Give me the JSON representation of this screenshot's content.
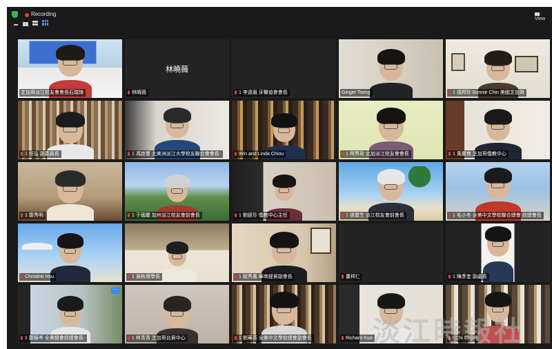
{
  "window": {
    "recording_label": "Recording",
    "view_button_label": "View"
  },
  "participants": [
    {
      "name": "芝加哥淡江校友會會長石瑞琦",
      "mic_off": false,
      "video": true
    },
    {
      "name": "林曉薇",
      "mic_off": true,
      "video": false
    },
    {
      "name": "1 李遠眉 牙醫協會會長",
      "mic_off": true,
      "video": false
    },
    {
      "name": "Ginger Tseng",
      "mic_off": false,
      "video": true
    },
    {
      "name": "1 項邦珍 Bonnie Chin 美國芝加哥",
      "mic_off": true,
      "video": true
    },
    {
      "name": "1 任弘 副委員長",
      "mic_off": true,
      "video": true
    },
    {
      "name": "1 馮啟豐 北美洲淡江大學校友聯合會會長-",
      "mic_off": true,
      "video": true
    },
    {
      "name": "Win and Linda Chiou",
      "mic_off": true,
      "video": true
    },
    {
      "name": "1 柯秀玫 北加淡江校友會會長",
      "mic_off": true,
      "video": true
    },
    {
      "name": "1 黃慶育 芝加哥僑教中心",
      "mic_off": true,
      "video": true
    },
    {
      "name": "1 鄭秀明",
      "mic_off": true,
      "video": true
    },
    {
      "name": "1 于國慶 加州淡江校友會前會長",
      "mic_off": true,
      "video": true
    },
    {
      "name": "1 劉經珍 僑教中心主任",
      "mic_off": true,
      "video": true
    },
    {
      "name": "1 張寶生 淡江校友會前會長",
      "mic_off": true,
      "video": true
    },
    {
      "name": "1 毛小冬 全美中文學校聯合總會 前總會長",
      "mic_off": true,
      "video": true
    },
    {
      "name": "Christine Hsu",
      "mic_off": true,
      "video": true
    },
    {
      "name": "1 吳秋燈學長",
      "mic_off": true,
      "video": true
    },
    {
      "name": "1 程秀鳳 華商經貿副會長",
      "mic_off": true,
      "video": true
    },
    {
      "name": "蕭祥仁",
      "mic_off": true,
      "video": false
    },
    {
      "name": "1 陳彥奎 副處長",
      "mic_off": true,
      "video": true
    },
    {
      "name": "1 鄭錦岑 全美總會前總會長-",
      "mic_off": true,
      "video": true
    },
    {
      "name": "1 林青青 芝加哥台貿中心",
      "mic_off": true,
      "video": true
    },
    {
      "name": "1 劉華英 全美中文學校總會副會長",
      "mic_off": true,
      "video": true
    },
    {
      "name": "Richard Kuo",
      "mic_off": true,
      "video": true
    },
    {
      "name": "I-Chi Chang",
      "mic_off": true,
      "video": true
    }
  ],
  "more_options_label": "···",
  "watermark": "淡江時報社",
  "colors": {
    "app_background": "#1a1a1a",
    "tile_background": "#242424",
    "active_speaker_border": "#c8e04a",
    "mic_muted": "#e04040",
    "recording": "#e5423b"
  }
}
